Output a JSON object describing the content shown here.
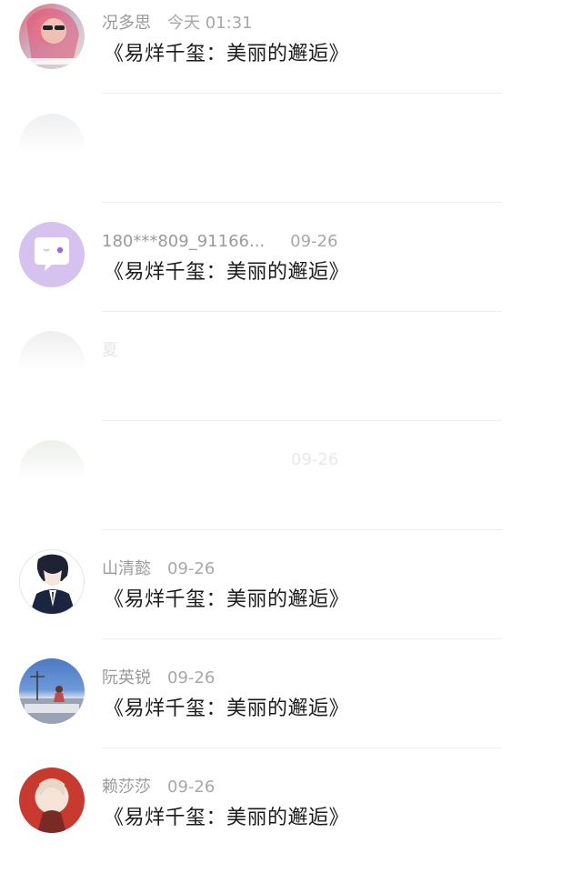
{
  "comments": [
    {
      "name": "况多思",
      "time": "今天 01:31",
      "text": "《易烊千玺：美丽的邂逅》",
      "avatar": "avatar-photo-pink-hair",
      "faded": false
    },
    {
      "name": "",
      "time": "",
      "text": "",
      "avatar": "avatar-faded",
      "faded": true
    },
    {
      "name": "180***809_91166...",
      "time": "09-26",
      "text": "《易烊千玺：美丽的邂逅》",
      "avatar": "avatar-chat-bubble-icon",
      "faded": false
    },
    {
      "name": "夏",
      "time": "",
      "text": "",
      "avatar": "avatar-faded",
      "faded": true
    },
    {
      "name": "",
      "time": "09-26",
      "text": "",
      "avatar": "avatar-faded",
      "faded": true
    },
    {
      "name": "山清懿",
      "time": "09-26",
      "text": "《易烊千玺：美丽的邂逅》",
      "avatar": "avatar-anime-boy",
      "faded": false
    },
    {
      "name": "阮英锐",
      "time": "09-26",
      "text": "《易烊千玺：美丽的邂逅》",
      "avatar": "avatar-sky-photo",
      "faded": false
    },
    {
      "name": "赖莎莎",
      "time": "09-26",
      "text": "《易烊千玺：美丽的邂逅》",
      "avatar": "avatar-anime-girl",
      "faded": false
    }
  ]
}
